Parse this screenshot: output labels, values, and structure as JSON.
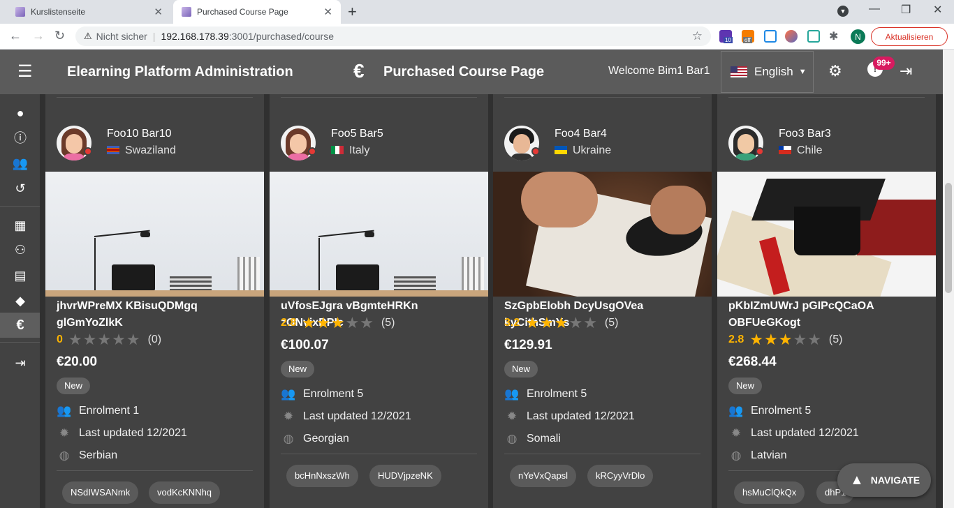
{
  "browser": {
    "tabs": [
      {
        "title": "Kurslistenseite"
      },
      {
        "title": "Purchased Course Page"
      }
    ],
    "address": {
      "security": "Nicht sicher",
      "host": "192.168.178.39",
      "path": ":3001/purchased/course"
    },
    "update_label": "Aktualisieren",
    "profile_initial": "N",
    "ext_badges": {
      "a": "10",
      "b": "off"
    }
  },
  "header": {
    "app_title": "Elearning Platform Administration",
    "page_icon": "€",
    "page_title": "Purchased Course Page",
    "welcome": "Welcome Bim1 Bar1",
    "language": "English",
    "notif_badge": "99+"
  },
  "courses": [
    {
      "user": "Foo10 Bar10",
      "country": "Swaziland",
      "title": "jhvrWPreMX KBisuQDMgq glGmYoZlkK",
      "rating": "0",
      "stars": 0,
      "reviews": "(0)",
      "price": "€20.00",
      "chip": "New",
      "enrolment": "Enrolment 1",
      "updated": "Last updated 12/2021",
      "language": "Serbian",
      "tags": [
        "NSdIWSANmk",
        "vodKcKNNhq"
      ]
    },
    {
      "user": "Foo5 Bar5",
      "country": "Italy",
      "title": "uVfosEJgra vBgmteHRKn zONvixDPIc",
      "rating": "2.8",
      "stars": 3,
      "reviews": "(5)",
      "price": "€100.07",
      "chip": "New",
      "enrolment": "Enrolment 5",
      "updated": "Last updated 12/2021",
      "language": "Georgian",
      "tags": [
        "bcHnNxszWh",
        "HUDVjpzeNK"
      ]
    },
    {
      "user": "Foo4 Bar4",
      "country": "Ukraine",
      "title": "SzGpbElobh DcyUsgOVea kyCithSmYs",
      "rating": "3.2",
      "stars": 3,
      "reviews": "(5)",
      "price": "€129.91",
      "chip": "New",
      "enrolment": "Enrolment 5",
      "updated": "Last updated 12/2021",
      "language": "Somali",
      "tags": [
        "nYeVxQapsl",
        "kRCyyVrDlo"
      ]
    },
    {
      "user": "Foo3 Bar3",
      "country": "Chile",
      "title": "pKbIZmUWrJ pGIPcQCaOA OBFUeGKogt",
      "rating": "2.8",
      "stars": 3,
      "reviews": "(5)",
      "price": "€268.44",
      "chip": "New",
      "enrolment": "Enrolment 5",
      "updated": "Last updated 12/2021",
      "language": "Latvian",
      "tags": [
        "hsMuClQkQx",
        "dhP1"
      ]
    }
  ],
  "navigate_label": "NAVIGATE",
  "colors": {
    "accent": "#ffb400",
    "header": "#5b5b5b",
    "card": "#424242",
    "background": "#303030",
    "badge": "#d81b60"
  }
}
